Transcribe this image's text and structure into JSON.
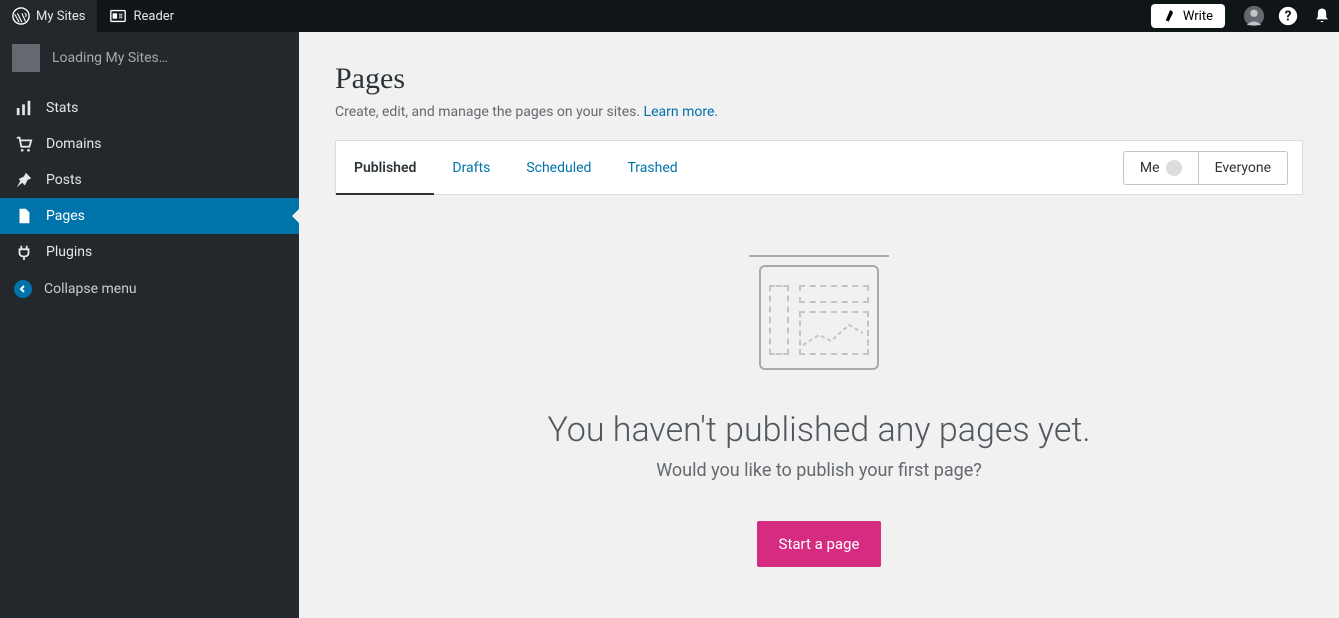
{
  "topbar": {
    "my_sites": "My Sites",
    "reader": "Reader",
    "write": "Write"
  },
  "sidebar": {
    "loading": "Loading My Sites…",
    "items": [
      {
        "label": "Stats"
      },
      {
        "label": "Domains"
      },
      {
        "label": "Posts"
      },
      {
        "label": "Pages"
      },
      {
        "label": "Plugins"
      }
    ],
    "collapse": "Collapse menu"
  },
  "header": {
    "title": "Pages",
    "subtitle": "Create, edit, and manage the pages on your sites. ",
    "learn_more": "Learn more."
  },
  "tabs": {
    "published": "Published",
    "drafts": "Drafts",
    "scheduled": "Scheduled",
    "trashed": "Trashed"
  },
  "segment": {
    "me": "Me",
    "everyone": "Everyone"
  },
  "empty": {
    "title": "You haven't published any pages yet.",
    "subtitle": "Would you like to publish your first page?",
    "cta": "Start a page"
  }
}
